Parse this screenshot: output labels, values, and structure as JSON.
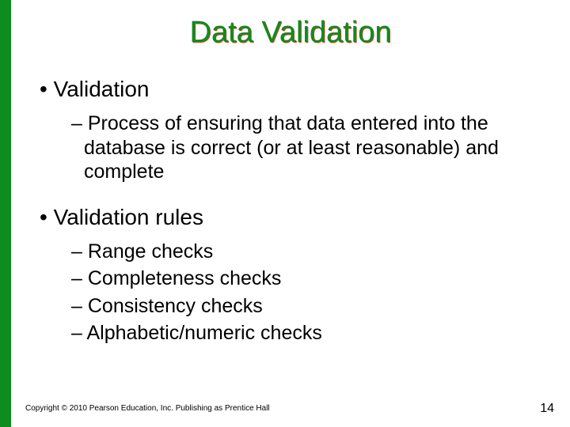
{
  "slide": {
    "title": "Data Validation",
    "sections": [
      {
        "heading": "Validation",
        "items": [
          "Process of ensuring that data entered into the database is correct (or at least reasonable) and complete"
        ]
      },
      {
        "heading": "Validation rules",
        "items": [
          "Range checks",
          "Completeness checks",
          "Consistency checks",
          "Alphabetic/numeric checks"
        ]
      }
    ],
    "copyright": "Copyright © 2010 Pearson Education, Inc. Publishing as Prentice Hall",
    "page_number": "14"
  }
}
